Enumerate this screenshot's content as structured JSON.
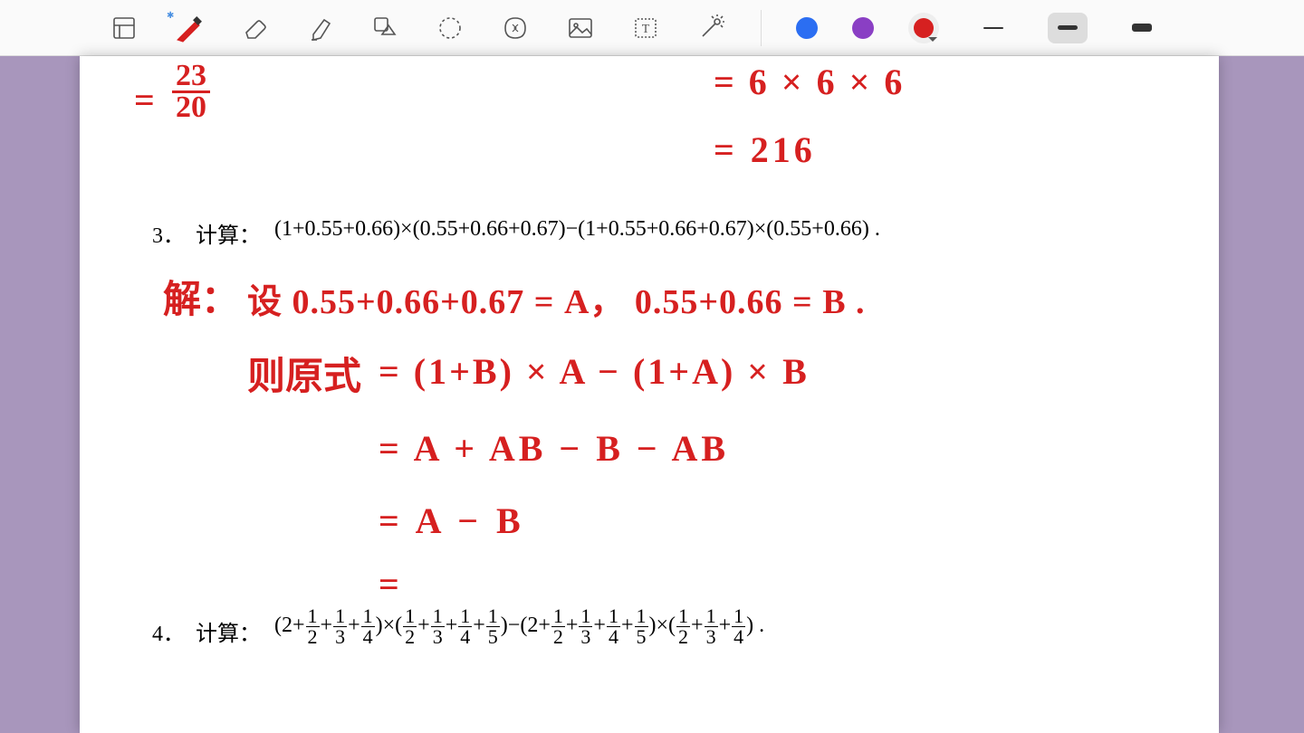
{
  "toolbar": {
    "colors": {
      "blue": "#2b6ef2",
      "purple": "#8a3fc4",
      "red": "#d62020"
    },
    "strokes": [
      2,
      5,
      9
    ]
  },
  "page": {
    "topleft_hand": "= 23/20",
    "topright_hand_1": "= 6 × 6 × 6",
    "topright_hand_2": "= 216",
    "p3_num": "3．",
    "p3_label": "计算：",
    "p3_expr": "(1+0.55+0.66)×(0.55+0.66+0.67)−(1+0.55+0.66+0.67)×(0.55+0.66) .",
    "sol_label": "解：",
    "sol_let": "设 0.55+0.66+0.67 = A， 0.55+0.66 = B .",
    "sol_then": "则原式",
    "sol_line1": "= (1+B) × A − (1+A) × B",
    "sol_line2": "= A + AB − B − AB",
    "sol_line3": "= A − B",
    "sol_line4": "=",
    "p4_num": "4．",
    "p4_label": "计算：",
    "p4_parts": [
      "(2+",
      "+",
      "+",
      ")×(",
      "+",
      "+",
      "+",
      ")−(2+",
      "+",
      "+",
      "+",
      ")×(",
      "+",
      "+",
      ") ."
    ],
    "p4_fracs": [
      [
        1,
        2
      ],
      [
        1,
        3
      ],
      [
        1,
        4
      ],
      [
        1,
        2
      ],
      [
        1,
        3
      ],
      [
        1,
        4
      ],
      [
        1,
        5
      ],
      [
        1,
        2
      ],
      [
        1,
        3
      ],
      [
        1,
        4
      ],
      [
        1,
        5
      ],
      [
        1,
        2
      ],
      [
        1,
        3
      ],
      [
        1,
        4
      ]
    ]
  }
}
